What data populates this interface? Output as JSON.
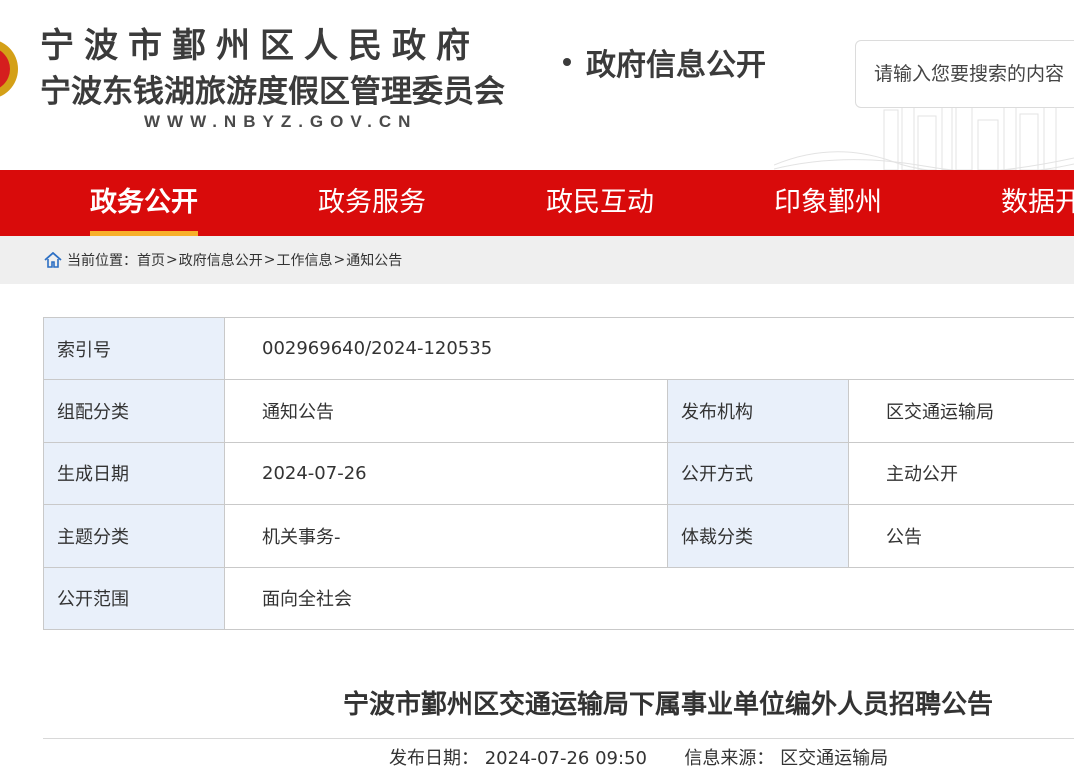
{
  "header": {
    "title_line1": "宁波市鄞州区人民政府",
    "title_line2": "宁波东钱湖旅游度假区管理委员会",
    "site_url": "WWW.NBYZ.GOV.CN",
    "section_name": "政府信息公开",
    "search_placeholder": "请输入您要搜索的内容",
    "accent_color": "#d90b0b"
  },
  "nav": {
    "items": [
      {
        "label": "政务公开",
        "active": true
      },
      {
        "label": "政务服务",
        "active": false
      },
      {
        "label": "政民互动",
        "active": false
      },
      {
        "label": "印象鄞州",
        "active": false
      },
      {
        "label": "数据开放",
        "active": false
      }
    ]
  },
  "breadcrumb": {
    "prefix": "当前位置：",
    "items": [
      "首页",
      "政府信息公开",
      "工作信息",
      "通知公告"
    ],
    "separator": ">"
  },
  "info": {
    "index_no_label": "索引号",
    "index_no": "002969640/2024-120535",
    "category_label": "组配分类",
    "category": "通知公告",
    "publisher_label": "发布机构",
    "publisher": "区交通运输局",
    "created_label": "生成日期",
    "created": "2024-07-26",
    "open_method_label": "公开方式",
    "open_method": "主动公开",
    "topic_label": "主题分类",
    "topic": "机关事务-",
    "genre_label": "体裁分类",
    "genre": "公告",
    "scope_label": "公开范围",
    "scope": "面向全社会"
  },
  "article": {
    "title": "宁波市鄞州区交通运输局下属事业单位编外人员招聘公告",
    "publish_date_label": "发布日期：",
    "publish_date": "2024-07-26 09:50",
    "source_label": "信息来源：",
    "source": "区交通运输局"
  }
}
